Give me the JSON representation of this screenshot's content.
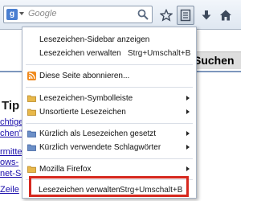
{
  "toolbar": {
    "search_engine_letter": "g",
    "search_placeholder": "Google",
    "icons": [
      "search-engine-icon",
      "magnifier-icon",
      "star-icon",
      "bookmarks-menu-icon",
      "download-icon",
      "home-icon"
    ]
  },
  "page": {
    "search_button": "Suchen",
    "heading": "Tip",
    "links": [
      "chtige",
      "chen\"",
      "rmitte",
      "ows-",
      "net-Se",
      "Zeile"
    ]
  },
  "menu": {
    "items": [
      {
        "label": "Lesezeichen-Sidebar anzeigen",
        "shortcut": ""
      },
      {
        "label": "Lesezeichen verwalten",
        "shortcut": "Strg+Umschalt+B"
      },
      {
        "label": "Diese Seite abonnieren...",
        "shortcut": ""
      },
      {
        "label": "Lesezeichen-Symbolleiste",
        "shortcut": ""
      },
      {
        "label": "Unsortierte Lesezeichen",
        "shortcut": ""
      },
      {
        "label": "Kürzlich als Lesezeichen gesetzt",
        "shortcut": ""
      },
      {
        "label": "Kürzlich verwendete Schlagwörter",
        "shortcut": ""
      },
      {
        "label": "Mozilla Firefox",
        "shortcut": ""
      },
      {
        "label": "Lesezeichen verwalten",
        "shortcut": "Strg+Umschalt+B"
      }
    ]
  },
  "colors": {
    "highlight_frame": "#d6281e",
    "rss": "#f08a1e",
    "folder": "#e8b84a",
    "smart_folder": "#6b8fc7"
  }
}
